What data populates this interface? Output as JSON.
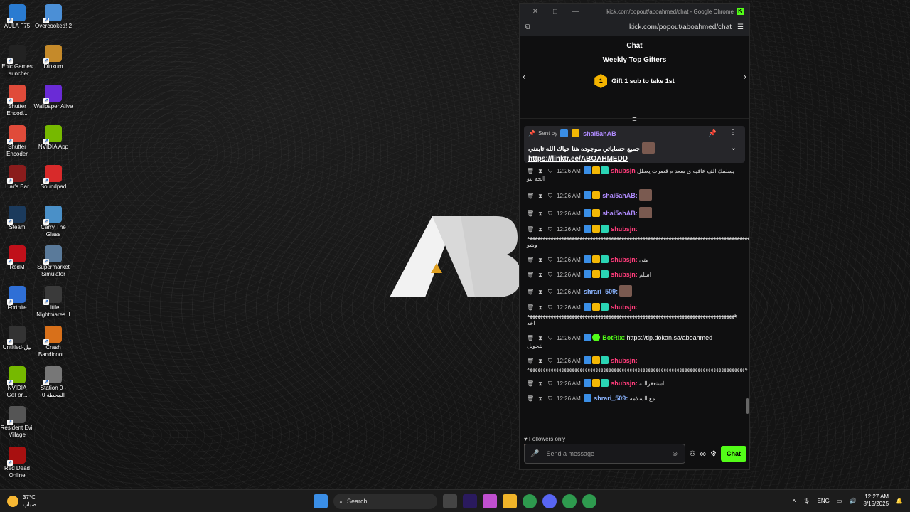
{
  "desktop": {
    "icons_col1": [
      {
        "label": "AULA F75",
        "color": "#2a7bd1"
      },
      {
        "label": "Epic Games Launcher",
        "color": "#222222"
      },
      {
        "label": "Shutter Encod...",
        "color": "#e04b3a"
      },
      {
        "label": "Shutter Encoder",
        "color": "#e04b3a"
      },
      {
        "label": "Liar's Bar",
        "color": "#8a1c1c"
      },
      {
        "label": "Steam",
        "color": "#1b3a5c"
      },
      {
        "label": "RedM",
        "color": "#c0101a"
      },
      {
        "label": "Fortnite",
        "color": "#2f6fd6"
      },
      {
        "label": "Untitled-بيل",
        "color": "#333333"
      },
      {
        "label": "NVIDIA GeFor...",
        "color": "#76b900"
      },
      {
        "label": "Resident Evil Village",
        "color": "#555555"
      },
      {
        "label": "Red Dead Online",
        "color": "#a81010"
      }
    ],
    "icons_col2": [
      {
        "label": "Overcooked! 2",
        "color": "#4b8fd6"
      },
      {
        "label": "Dinkum",
        "color": "#c58a2a"
      },
      {
        "label": "Wallpaper Alive",
        "color": "#6a2bd6"
      },
      {
        "label": "NVIDIA App",
        "color": "#76b900"
      },
      {
        "label": "Soundpad",
        "color": "#d82a2a"
      },
      {
        "label": "Carry The Glass",
        "color": "#4a90c8"
      },
      {
        "label": "Supermarket Simulator",
        "color": "#5a7a9a"
      },
      {
        "label": "Little Nightmares II",
        "color": "#3a3a3a"
      },
      {
        "label": "Crash Bandicoot...",
        "color": "#d8701a"
      },
      {
        "label": "Station 0 - المحطة 0",
        "color": "#777777"
      }
    ]
  },
  "window": {
    "title": "kick.com/popout/aboahmed/chat - Google Chrome",
    "url": "kick.com/popout/aboahmed/chat",
    "controls": {
      "close": "✕",
      "maximize": "□",
      "minimize": "—"
    }
  },
  "chat": {
    "header": "Chat",
    "gifters_title": "Weekly Top Gifters",
    "gift_rank": "1",
    "gift_text": "Gift 1 sub to take 1st",
    "pinned": {
      "sent_by_label": "Sent by",
      "sender": "shai5ahAB",
      "message": "جميع حساباتي موجوده هنا حياك الله تابعني",
      "link": "https://linktr.ee/ABOAHMEDD"
    },
    "messages": [
      {
        "time": "12:26 AM",
        "user": "shubsjn",
        "color": "pink",
        "text": "يسلمك الف عافيه ي سعد م قصرت يعطل الجه بيو",
        "badges": [
          "blue",
          "gold",
          "teal"
        ]
      },
      {
        "time": "12:26 AM",
        "user": "shai5ahAB:",
        "color": "purple",
        "text": "",
        "badges": [
          "blue",
          "gold"
        ],
        "emote": true
      },
      {
        "time": "12:26 AM",
        "user": "shai5ahAB:",
        "color": "purple",
        "text": "",
        "badges": [
          "blue",
          "gold"
        ],
        "emote": true
      },
      {
        "time": "12:26 AM",
        "user": "shubsjn:",
        "color": "pink",
        "text": "ههههههههههههههههههههههههههههههههههههههههههههههههههههههههههههههههههههههههههههههههههههههه وشو",
        "badges": [
          "blue",
          "gold",
          "teal"
        ]
      },
      {
        "time": "12:26 AM",
        "user": "shubsjn:",
        "color": "pink",
        "text": "متى",
        "badges": [
          "blue",
          "gold",
          "teal"
        ]
      },
      {
        "time": "12:26 AM",
        "user": "shubsjn:",
        "color": "pink",
        "text": "اسلم",
        "badges": [
          "blue",
          "gold",
          "teal"
        ]
      },
      {
        "time": "12:26 AM",
        "user": "shrari_509:",
        "color": "blue",
        "text": "",
        "badges": [],
        "emote": true
      },
      {
        "time": "12:26 AM",
        "user": "shubsjn:",
        "color": "pink",
        "text": "هههههههههههههههههههههههههههههههههههههههههههههههههههههههههههههههههههههههههههههههه اخه",
        "badges": [
          "blue",
          "gold",
          "teal"
        ]
      },
      {
        "time": "12:26 AM",
        "user": "BotRix:",
        "color": "green",
        "text": "لتحويل",
        "link": "https://tip.dokan.sa/aboahmed",
        "badges": [
          "blue",
          "green"
        ]
      },
      {
        "time": "12:26 AM",
        "user": "shubsjn:",
        "color": "pink",
        "text": "هههههههههههههههههههههههههههههههههههههههههههههههههههههههههههههههههههههههههههههههههههه",
        "badges": [
          "blue",
          "gold",
          "teal"
        ]
      },
      {
        "time": "12:26 AM",
        "user": "shubsjn:",
        "color": "pink",
        "text": "استغفرالله",
        "badges": [
          "blue",
          "gold",
          "teal"
        ]
      },
      {
        "time": "12:26 AM",
        "user": "shrari_509:",
        "color": "blue",
        "text": "مع السلامه",
        "badges": [
          "blue"
        ]
      }
    ],
    "followers_only": "Followers only",
    "input_placeholder": "Send a message",
    "chat_button": "Chat"
  },
  "taskbar": {
    "temperature": "37°C",
    "weather_desc": "ضباب",
    "search_label": "Search",
    "language": "ENG",
    "time": "12:27 AM",
    "date": "8/15/2025"
  }
}
